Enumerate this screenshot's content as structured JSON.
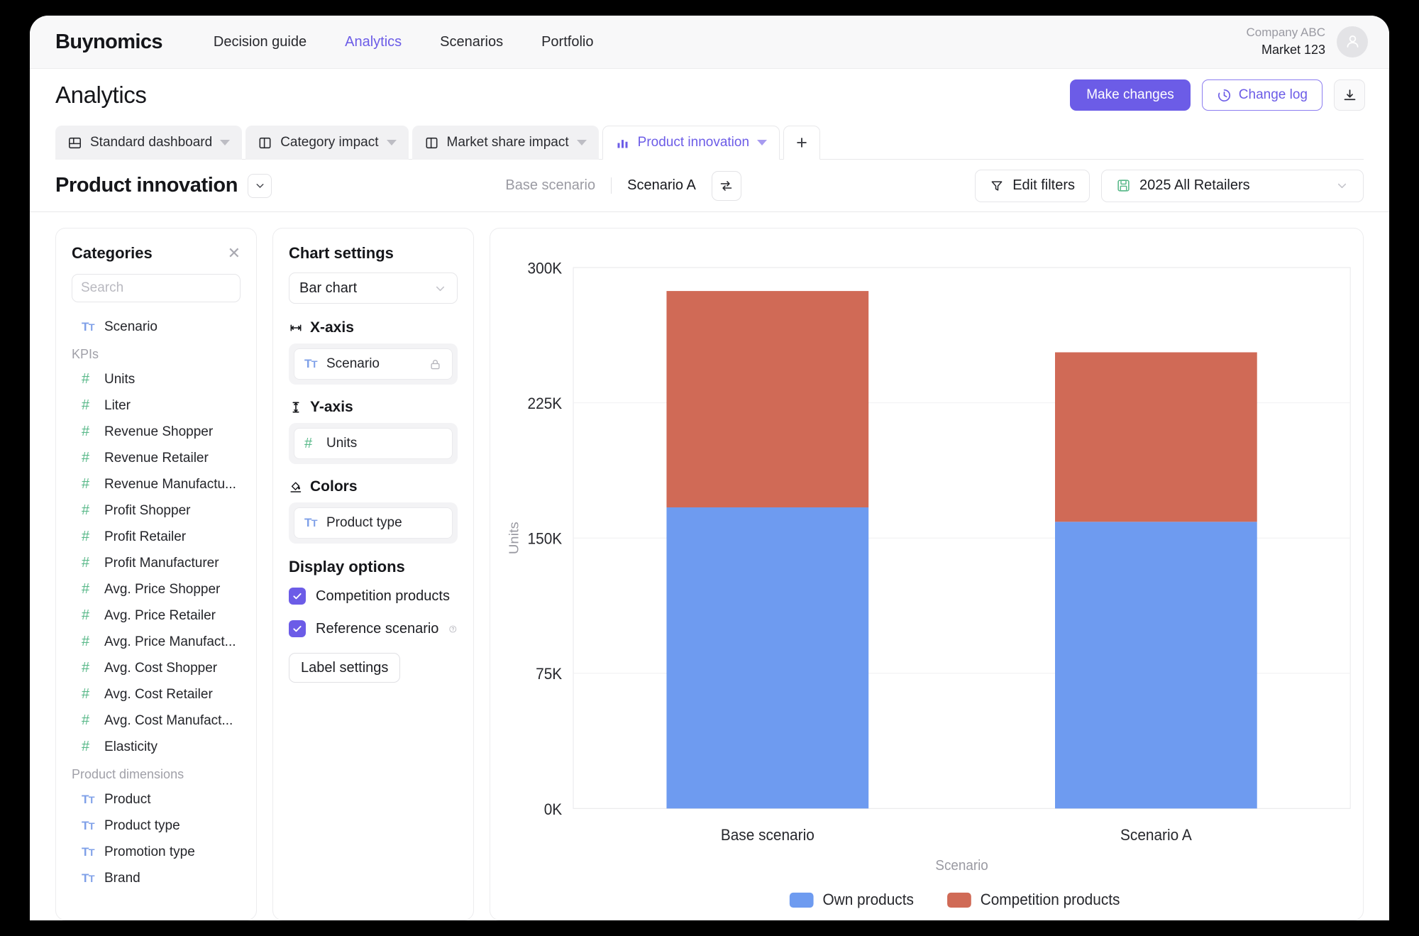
{
  "topnav": {
    "brand": "Buynomics",
    "links": [
      {
        "label": "Decision guide",
        "active": false
      },
      {
        "label": "Analytics",
        "active": true
      },
      {
        "label": "Scenarios",
        "active": false
      },
      {
        "label": "Portfolio",
        "active": false
      }
    ],
    "company": "Company ABC",
    "market": "Market 123"
  },
  "pagehead": {
    "title": "Analytics",
    "make_changes": "Make changes",
    "change_log": "Change log"
  },
  "tabs": [
    {
      "label": "Standard dashboard",
      "icon": "dashboard-icon",
      "active": false
    },
    {
      "label": "Category impact",
      "icon": "layout-icon",
      "active": false
    },
    {
      "label": "Market share impact",
      "icon": "layout-icon",
      "active": false
    },
    {
      "label": "Product innovation",
      "icon": "bar-chart-icon",
      "active": true
    }
  ],
  "tab_add_label": "+",
  "subhead": {
    "title": "Product innovation",
    "base_scenario": "Base scenario",
    "compare_scenario": "Scenario A",
    "edit_filters": "Edit filters",
    "retailers_value": "2025 All Retailers"
  },
  "categories": {
    "title": "Categories",
    "search_placeholder": "Search",
    "search_value": "",
    "top_items": [
      {
        "label": "Scenario",
        "icon": "text-type-icon"
      }
    ],
    "groups": [
      {
        "label": "KPIs",
        "items": [
          {
            "label": "Units",
            "icon": "number-type-icon"
          },
          {
            "label": "Liter",
            "icon": "number-type-icon"
          },
          {
            "label": "Revenue Shopper",
            "icon": "number-type-icon"
          },
          {
            "label": "Revenue Retailer",
            "icon": "number-type-icon"
          },
          {
            "label": "Revenue Manufactu...",
            "icon": "number-type-icon"
          },
          {
            "label": "Profit Shopper",
            "icon": "number-type-icon"
          },
          {
            "label": "Profit Retailer",
            "icon": "number-type-icon"
          },
          {
            "label": "Profit Manufacturer",
            "icon": "number-type-icon"
          },
          {
            "label": "Avg. Price Shopper",
            "icon": "number-type-icon"
          },
          {
            "label": "Avg. Price Retailer",
            "icon": "number-type-icon"
          },
          {
            "label": "Avg. Price Manufact...",
            "icon": "number-type-icon"
          },
          {
            "label": "Avg. Cost Shopper",
            "icon": "number-type-icon"
          },
          {
            "label": "Avg. Cost Retailer",
            "icon": "number-type-icon"
          },
          {
            "label": "Avg. Cost Manufact...",
            "icon": "number-type-icon"
          },
          {
            "label": "Elasticity",
            "icon": "number-type-icon"
          }
        ]
      },
      {
        "label": "Product dimensions",
        "items": [
          {
            "label": "Product",
            "icon": "text-type-icon"
          },
          {
            "label": "Product type",
            "icon": "text-type-icon"
          },
          {
            "label": "Promotion type",
            "icon": "text-type-icon"
          },
          {
            "label": "Brand",
            "icon": "text-type-icon"
          }
        ]
      }
    ]
  },
  "chart_settings": {
    "title": "Chart settings",
    "chart_type": "Bar chart",
    "x_axis_label": "X-axis",
    "x_axis_value": "Scenario",
    "y_axis_label": "Y-axis",
    "y_axis_value": "Units",
    "colors_label": "Colors",
    "colors_value": "Product type",
    "display_options_title": "Display options",
    "competition_products": "Competition products",
    "competition_products_checked": true,
    "reference_scenario": "Reference scenario",
    "reference_scenario_checked": true,
    "label_settings": "Label settings"
  },
  "theme": {
    "accent": "#6c5ce7",
    "own_products": "#6e9bf0",
    "competition_products": "#d06a56",
    "green_icon": "#5ab98a",
    "blue_icon": "#7fa0e8"
  },
  "chart_data": {
    "type": "bar",
    "stacked": true,
    "title": "",
    "xlabel": "Scenario",
    "ylabel": "Units",
    "categories": [
      "Base scenario",
      "Scenario A"
    ],
    "series": [
      {
        "name": "Own products",
        "color": "#6e9bf0",
        "values": [
          167000,
          159000
        ]
      },
      {
        "name": "Competition products",
        "color": "#d06a56",
        "values": [
          120000,
          94000
        ]
      }
    ],
    "totals": [
      287000,
      253000
    ],
    "ylim": [
      0,
      300000
    ],
    "yticks": [
      0,
      75000,
      150000,
      225000,
      300000
    ],
    "ytick_labels": [
      "0K",
      "75K",
      "150K",
      "225K",
      "300K"
    ],
    "grid": true,
    "legend_position": "bottom",
    "legend": [
      "Own products",
      "Competition products"
    ]
  }
}
